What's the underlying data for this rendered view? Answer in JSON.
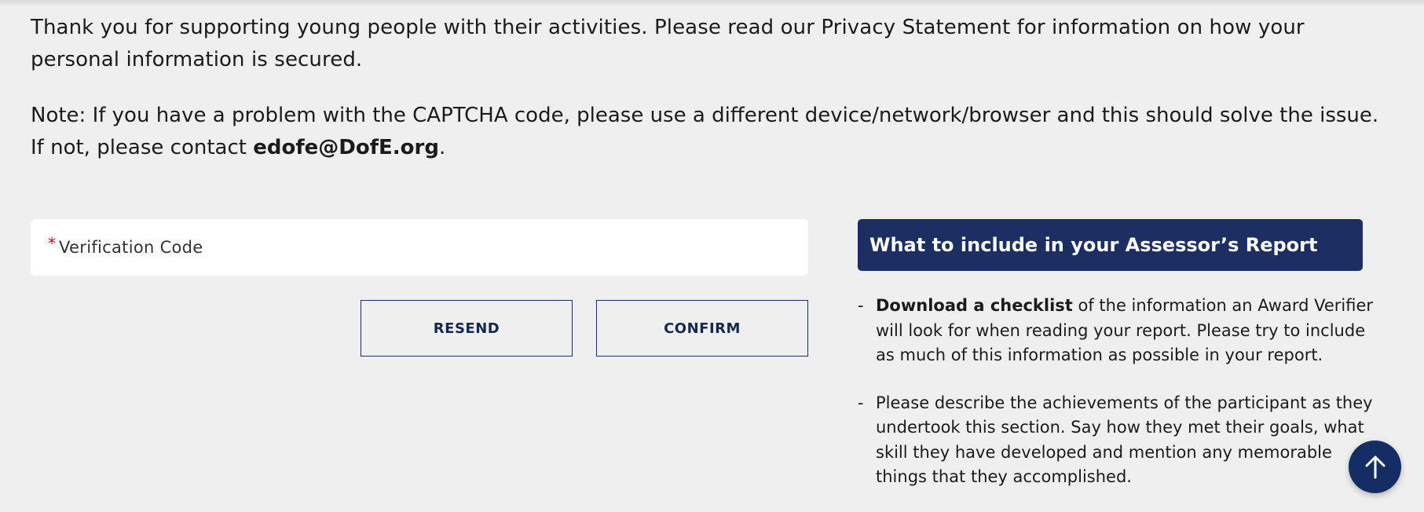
{
  "intro": {
    "text": "Thank you for supporting young people with their activities. Please read our Privacy Statement for information on how your personal information is secured."
  },
  "note": {
    "text_before": "Note: If you have a problem with the CAPTCHA code, please use a different device/network/browser and this should solve the issue. If not, please contact ",
    "email": "edofe@DofE.org",
    "text_after": "."
  },
  "form": {
    "required_mark": "*",
    "verification_placeholder": "Verification Code",
    "resend_label": "RESEND",
    "confirm_label": "CONFIRM"
  },
  "panel": {
    "title": "What to include in your Assessor’s Report",
    "items": [
      {
        "bullet": "-",
        "bold": "Download a checklist",
        "text": " of the information an Award Verifier will look for when reading your report. Please try to include as much of this information as possible in your report."
      },
      {
        "bullet": "-",
        "bold": "",
        "text": "Please describe the achievements of the participant as they undertook this section. Say how they met their goals, what skill they have developed and mention any memorable things that they accomplished."
      }
    ]
  },
  "scroll_top": {
    "icon": "arrow-up-icon"
  },
  "colors": {
    "background": "#efefef",
    "navy": "#1c2f63",
    "required": "#d0021b"
  }
}
